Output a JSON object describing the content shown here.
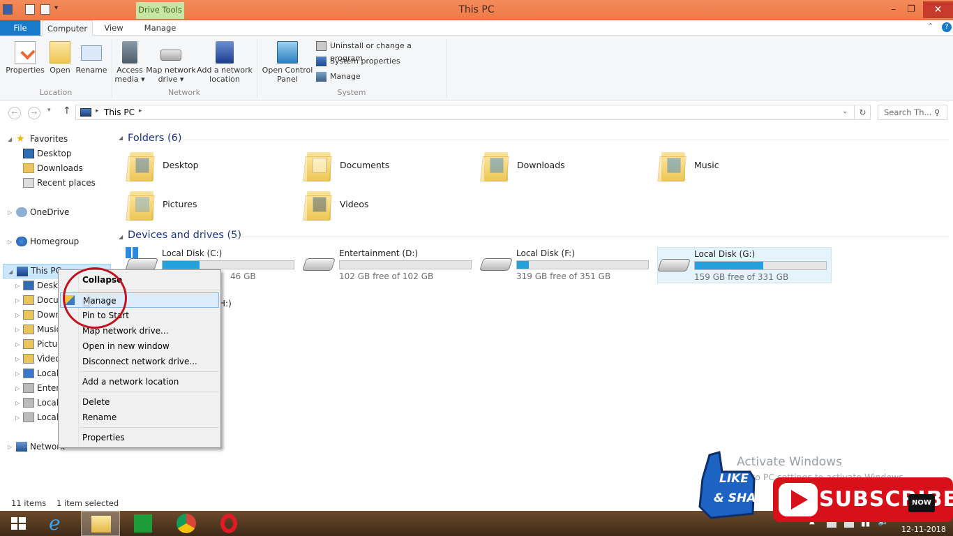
{
  "window": {
    "title": "This PC",
    "context_tab": "Drive Tools"
  },
  "tabs": [
    {
      "label": "File"
    },
    {
      "label": "Computer"
    },
    {
      "label": "View"
    },
    {
      "label": "Manage"
    }
  ],
  "ribbon": {
    "location": {
      "label": "Location",
      "buttons": [
        "Properties",
        "Open",
        "Rename"
      ]
    },
    "network": {
      "label": "Network",
      "access_media": [
        "Access",
        "media ▾"
      ],
      "map_drive": [
        "Map network",
        "drive ▾"
      ],
      "add_location": [
        "Add a network",
        "location"
      ]
    },
    "system": {
      "label": "System",
      "open_cp": [
        "Open Control",
        "Panel"
      ],
      "items": [
        "Uninstall or change a program",
        "System properties",
        "Manage"
      ]
    }
  },
  "address": {
    "path": "This PC",
    "search_placeholder": "Search Th..."
  },
  "nav": {
    "favorites": "Favorites",
    "fav_items": [
      "Desktop",
      "Downloads",
      "Recent places"
    ],
    "onedrive": "OneDrive",
    "homegroup": "Homegroup",
    "this_pc": "This PC",
    "pc_items": [
      "Deskt",
      "Docu",
      "Down",
      "Music",
      "Pictur",
      "Video",
      "Local",
      "Enter",
      "Local",
      "Local"
    ],
    "network": "Network"
  },
  "content": {
    "folders_header": "Folders (6)",
    "folders": [
      "Desktop",
      "Documents",
      "Downloads",
      "Music",
      "Pictures",
      "Videos"
    ],
    "drives_header": "Devices and drives (5)",
    "drives": [
      {
        "name": "Local Disk (C:)",
        "free": "46 GB",
        "used_fraction": 0.28
      },
      {
        "name": "Entertainment (D:)",
        "free": "102 GB free of 102 GB",
        "used_fraction": 0.0
      },
      {
        "name": "Local Disk (F:)",
        "free": "319 GB free of 351 GB",
        "used_fraction": 0.09
      },
      {
        "name": "Local Disk (G:)",
        "free": "159 GB free of 331 GB",
        "used_fraction": 0.52
      }
    ],
    "partial_drive": "H:)"
  },
  "context_menu": {
    "items": [
      "Collapse",
      "Manage",
      "Pin to Start",
      "Map network drive...",
      "Open in new window",
      "Disconnect network drive...",
      "Add a network location",
      "Delete",
      "Rename",
      "Properties"
    ]
  },
  "status": {
    "count": "11 items",
    "selected": "1 item selected"
  },
  "watermark": {
    "line1": "Activate Windows",
    "line2": "Go to PC settings to activate Windows."
  },
  "overlay": {
    "subscribe": "SUBSCRIBE",
    "like": "LIKE",
    "share": "& SHARE",
    "now": "NOW"
  },
  "tray": {
    "date": "12-11-2018"
  },
  "colors": {
    "titlebar": "#ef7a48",
    "accent": "#1979ca",
    "ring": "#c1121f",
    "subscribe": "#d7101a"
  }
}
